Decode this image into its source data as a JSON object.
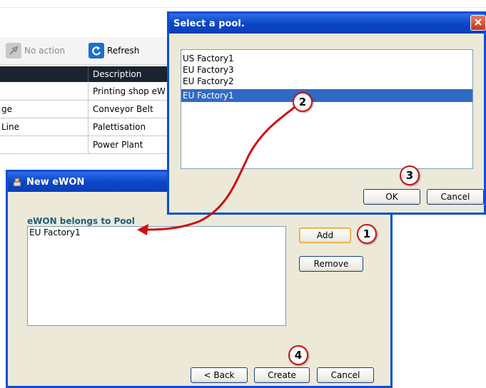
{
  "toolbar": {
    "no_action_label": "No action",
    "refresh_label": "Refresh"
  },
  "grid": {
    "description_header": "Description",
    "rows": [
      {
        "name_fragment": "",
        "description": "Printing shop eW"
      },
      {
        "name_fragment": "ge",
        "description": "Conveyor Belt"
      },
      {
        "name_fragment": "Line",
        "description": "Palettisation"
      },
      {
        "name_fragment": "",
        "description": "Power Plant"
      }
    ]
  },
  "select_pool_dialog": {
    "title": "Select a pool.",
    "pools": [
      "US Factory1",
      "EU Factory3",
      "EU Factory2",
      "EU Factory1"
    ],
    "selected_index": 3,
    "ok_label": "OK",
    "cancel_label": "Cancel"
  },
  "new_ewon_dialog": {
    "title": "New eWON",
    "pool_section_label": "eWON belongs to Pool",
    "pools": [
      "EU Factory1"
    ],
    "add_label": "Add",
    "remove_label": "Remove",
    "back_label": "< Back",
    "create_label": "Create",
    "cancel_label": "Cancel"
  },
  "callouts": [
    "1",
    "2",
    "3",
    "4"
  ],
  "colors": {
    "titlebar": "#0a4fd4",
    "selection": "#316ac5",
    "grid_header": "#1a2330",
    "callout_red": "#d01010",
    "section_label": "#1f5f80"
  }
}
